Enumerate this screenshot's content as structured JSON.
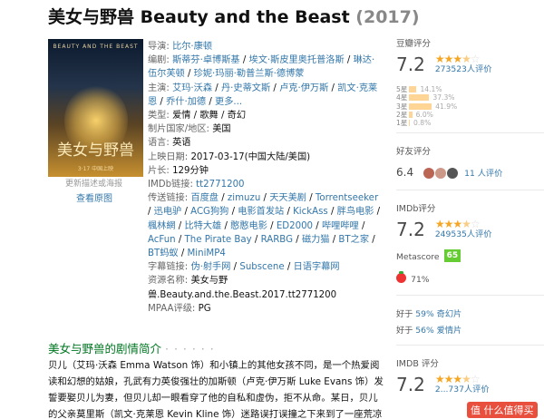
{
  "title": {
    "name": "美女与野兽 Beauty and the Beast",
    "year": "(2017)"
  },
  "poster": {
    "top_text": "BEAUTY AND THE BEAST",
    "title_text": "美女与野兽",
    "bottom_text": "3·17 中国上映",
    "more_link": "更新描述或海报",
    "view_link": "查看原图"
  },
  "info": {
    "director_label": "导演:",
    "director": "比尔·康顿",
    "writer_label": "编剧:",
    "writers": [
      "斯蒂芬·卓博斯基",
      "埃文·斯皮里奥托普洛斯",
      "琳达·伍尔芙顿",
      "珍妮·玛丽·勒普兰斯·德博蒙"
    ],
    "cast_label": "主演:",
    "cast": [
      "艾玛·沃森",
      "丹·史蒂文斯",
      "卢克·伊万斯",
      "凯文·克莱恩",
      "乔什·加德"
    ],
    "cast_more": "更多...",
    "genre_label": "类型:",
    "genre": "爱情 / 歌舞 / 奇幻",
    "country_label": "制片国家/地区:",
    "country": "美国",
    "language_label": "语言:",
    "language": "英语",
    "release_label": "上映日期:",
    "release": "2017-03-17(中国大陆/美国)",
    "runtime_label": "片长:",
    "runtime": "129分钟",
    "imdb_label": "IMDb链接:",
    "imdb": "tt2771200",
    "links_label": "传送链接:",
    "links": [
      "百度盘",
      "zimuzu",
      "天天美剧",
      "Torrentseeker",
      "迅电驴",
      "ACG狗狗",
      "电影首发站",
      "KickAss",
      "胖鸟电影",
      "楓林網",
      "比特大雄",
      "憨憨电影",
      "ED2000",
      "哔哩哔哩",
      "AcFun",
      "The Pirate Bay",
      "RARBG",
      "磁力猫",
      "BT之家",
      "BT蚂蚁",
      "MiniMP4"
    ],
    "sub_label": "字幕链接:",
    "subs": [
      "伪·射手网",
      "Subscene",
      "日语字幕网"
    ],
    "resource_label": "资源名称:",
    "resource": "美女与野兽.Beauty.and.the.Beast.2017.tt2771200",
    "mpaa_label": "MPAA评级:",
    "mpaa": "PG"
  },
  "synopsis": {
    "heading": "美女与野兽的剧情简介",
    "dots": "· · · · · ·",
    "text": "贝儿（艾玛·沃森 Emma Watson 饰）和小镇上的其他女孩不同，是一个热爱阅读和幻想的姑娘，孔武有力英俊强壮的加斯顿（卢克·伊万斯 Luke Evans 饰）发誓要娶贝儿为妻，但贝儿却一眼看穿了他的自私和虚伪，拒不从命。某日，贝儿的父亲莫里斯（凯文·克莱恩 Kevin Kline 饰）迷路误打误撞之下来到了一座荒凉破败的城"
  },
  "douban": {
    "label": "豆瓣评分",
    "score": "7.2",
    "stars": 3.5,
    "count": "273523人评价",
    "dist": [
      {
        "star": "5星",
        "pct": "14.1%",
        "value": 14.1
      },
      {
        "star": "4星",
        "pct": "37.3%",
        "value": 37.3
      },
      {
        "star": "3星",
        "pct": "41.9%",
        "value": 41.9
      },
      {
        "star": "2星",
        "pct": "6.0%",
        "value": 6.0
      },
      {
        "star": "1星",
        "pct": "0.8%",
        "value": 0.8
      }
    ]
  },
  "friends": {
    "label": "好友评分",
    "score": "6.4",
    "count": "11 人评价",
    "avatar_colors": [
      "#b65",
      "#c98",
      "#555"
    ]
  },
  "imdb": {
    "label": "IMDb评分",
    "score": "7.2",
    "stars": 3.5,
    "count": "249535人评价"
  },
  "metascore": {
    "label": "Metascore",
    "value": "65",
    "tomato_pct": "71%"
  },
  "better": {
    "prefix1": "好于",
    "pct1": "59%",
    "cat1": "奇幻片",
    "prefix2": "好于",
    "pct2": "56%",
    "cat2": "爱情片"
  },
  "imdb2": {
    "label": "IMDB 评分",
    "score": "7.2",
    "stars": 3.5,
    "count": "2...737人评价"
  },
  "watermark": "值 什么值得买"
}
